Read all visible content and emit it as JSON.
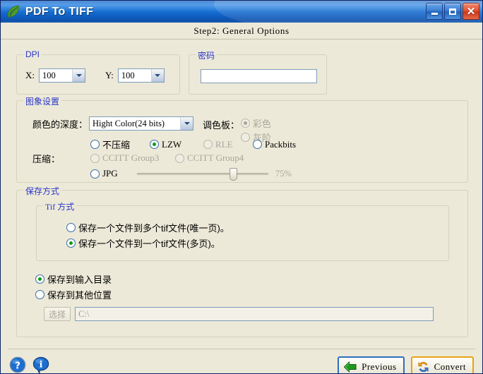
{
  "window": {
    "title": "PDF To TIFF",
    "app_icon": "leaf-icon",
    "minimize_label": "_",
    "maximize_label": "□",
    "close_label": "✕"
  },
  "step": {
    "title": "Step2: General Options"
  },
  "dpi_group": {
    "title": "DPI",
    "x_label": "X:",
    "x_value": "100",
    "y_label": "Y:",
    "y_value": "100"
  },
  "password_group": {
    "title": "密码",
    "value": "",
    "placeholder": ""
  },
  "image_group": {
    "title": "图象设置",
    "color_depth_label": "颜色的深度：",
    "color_depth_value": "Hight Color(24 bits)",
    "palette_label": "调色板：",
    "palette_options": [
      {
        "label": "彩色",
        "checked": true,
        "disabled": true
      },
      {
        "label": "灰阶",
        "checked": false,
        "disabled": true
      }
    ],
    "compression_label": "压缩：",
    "compression_options": [
      {
        "label": "不压缩",
        "checked": false,
        "disabled": false,
        "cn": true
      },
      {
        "label": "LZW",
        "checked": true,
        "disabled": false,
        "cn": false
      },
      {
        "label": "RLE",
        "checked": false,
        "disabled": true,
        "cn": false
      },
      {
        "label": "Packbits",
        "checked": false,
        "disabled": false,
        "cn": false
      },
      {
        "label": "CCITT Group3",
        "checked": false,
        "disabled": true,
        "cn": false
      },
      {
        "label": "CCITT Group4",
        "checked": false,
        "disabled": true,
        "cn": false
      },
      {
        "label": "JPG",
        "checked": false,
        "disabled": false,
        "cn": false
      }
    ],
    "jpg_quality": "75%",
    "jpg_quality_value": 75
  },
  "save_group": {
    "title": "保存方式",
    "tif_group_title": "Tif 方式",
    "tif_options": [
      {
        "label": "保存一个文件到多个tif文件(唯一页)。",
        "checked": false
      },
      {
        "label": "保存一个文件到一个tif文件(多页)。",
        "checked": true
      }
    ],
    "location_options": [
      {
        "label": "保存到输入目录",
        "checked": true
      },
      {
        "label": "保存到其他位置",
        "checked": false
      }
    ],
    "browse_label": "选择",
    "path_value": "C:\\"
  },
  "footer": {
    "help_icon": "help-circle-icon",
    "info_icon": "info-bubble-icon",
    "previous_label": "Previous",
    "convert_label": "Convert"
  },
  "colors": {
    "titlebar_blue": "#1c76d8",
    "group_title_blue": "#2a35c8",
    "window_bg": "#ece9d8",
    "convert_border": "#e8a317",
    "previous_border": "#2f6fbd",
    "radio_dot_green": "#0a9b18"
  }
}
